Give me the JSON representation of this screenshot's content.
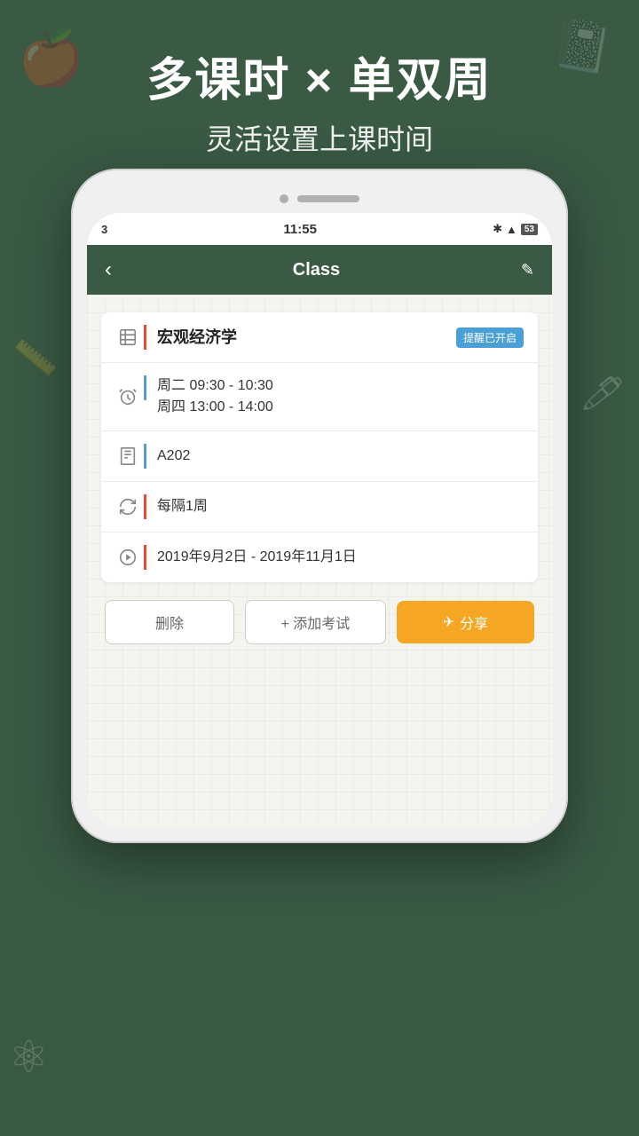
{
  "background": {
    "color": "#3a5a44"
  },
  "top": {
    "main_title": "多课时 × 单双周",
    "sub_title": "灵活设置上课时间"
  },
  "status_bar": {
    "left": "3",
    "time": "11:55",
    "battery": "53"
  },
  "header": {
    "back_icon": "‹",
    "title": "Class",
    "edit_icon": "✎"
  },
  "course": {
    "name": "宏观经济学",
    "reminder_label": "提醒已开启",
    "time_line1": "周二 09:30 - 10:30",
    "time_line2": "周四 13:00 - 14:00",
    "location": "A202",
    "interval": "每隔1周",
    "date_range": "2019年9月2日 - 2019年11月1日"
  },
  "buttons": {
    "delete": "删除",
    "add_exam": "+ 添加考试",
    "share_icon": "✈",
    "share": "分享"
  }
}
